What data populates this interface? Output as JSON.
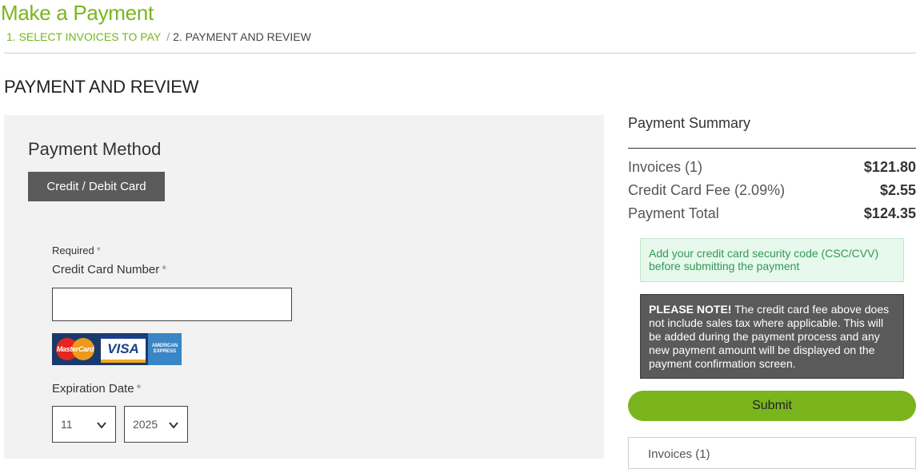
{
  "page": {
    "title": "Make a Payment",
    "breadcrumb": {
      "step1": "1. SELECT INVOICES TO PAY",
      "separator": "/",
      "step2": "2. PAYMENT AND REVIEW"
    },
    "section_heading": "PAYMENT AND REVIEW"
  },
  "payment_method": {
    "heading": "Payment Method",
    "selected_method": "Credit / Debit Card",
    "required_note": "Required",
    "required_mark": "*",
    "card_number_label": "Credit Card Number",
    "card_number_value": "",
    "card_logos": {
      "mastercard": "MasterCard",
      "visa": "VISA",
      "amex": "AMERICAN EXPRESS"
    },
    "expiration_label": "Expiration Date",
    "expiration_month": "11",
    "expiration_year": "2025"
  },
  "summary": {
    "heading": "Payment Summary",
    "rows": [
      {
        "label": "Invoices (1)",
        "value": "$121.80"
      },
      {
        "label": "Credit Card Fee (2.09%)",
        "value": "$2.55"
      },
      {
        "label": "Payment Total",
        "value": "$124.35"
      }
    ],
    "info_message": "Add your credit card security code (CSC/CVV) before submitting the payment",
    "note_strong": "PLEASE NOTE!",
    "note_text": "The credit card fee above does not include sales tax where applicable. This will be added during the payment process and any new payment amount will be displayed on the payment confirmation screen.",
    "submit_label": "Submit",
    "invoices_box_label": "Invoices (1)"
  },
  "colors": {
    "brand_green": "#7ab51d",
    "dark_button": "#5a5a5a",
    "info_bg": "#e7f8ec",
    "info_text": "#2e9a56"
  }
}
